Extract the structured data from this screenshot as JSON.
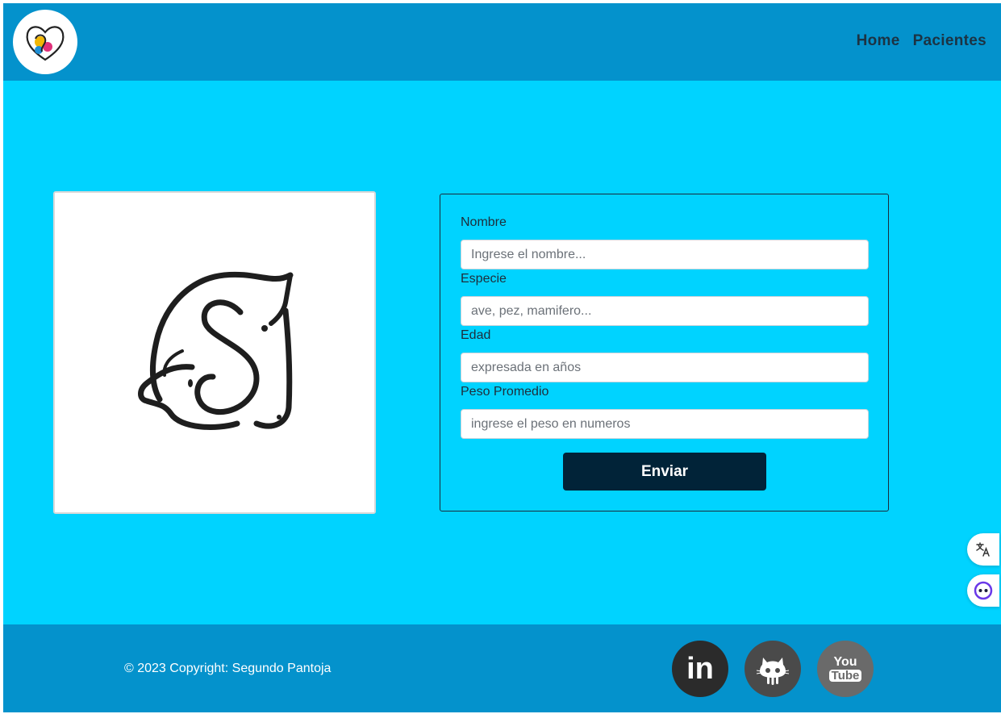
{
  "nav": {
    "links": [
      "Home",
      "Pacientes"
    ]
  },
  "form": {
    "fields": [
      {
        "label": "Nombre",
        "placeholder": "Ingrese el nombre..."
      },
      {
        "label": "Especie",
        "placeholder": "ave, pez, mamifero..."
      },
      {
        "label": "Edad",
        "placeholder": "expresada en años"
      },
      {
        "label": "Peso Promedio",
        "placeholder": "ingrese el peso en numeros"
      }
    ],
    "submit_label": "Enviar"
  },
  "footer": {
    "copyright": "© 2023 Copyright: Segundo Pantoja",
    "social": [
      {
        "name": "linkedin",
        "glyph": "in",
        "color": "#2b2b2b"
      },
      {
        "name": "github",
        "color": "#4a4a4a"
      },
      {
        "name": "youtube",
        "line1": "You",
        "line2": "Tube",
        "color": "#6a6a6a"
      }
    ]
  },
  "colors": {
    "navbar": "#0492cc",
    "page": "#00d3ff",
    "button": "#012338",
    "nav_text": "#1c3343"
  },
  "icons": [
    "vet-logo-icon",
    "dog-cat-logo-icon",
    "translate-icon",
    "assistant-icon",
    "linkedin-icon",
    "github-icon",
    "youtube-icon"
  ]
}
